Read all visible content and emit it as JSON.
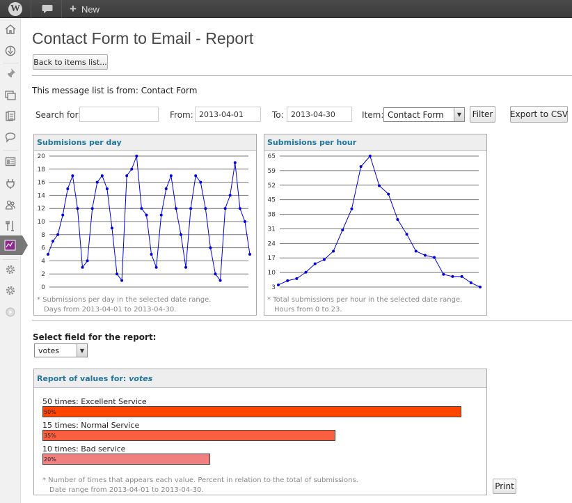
{
  "adminbar": {
    "new_label": "New"
  },
  "page": {
    "title": "Contact Form to Email - Report",
    "back_button": "Back to items list...",
    "message_list_from": "This message list is from: Contact Form"
  },
  "filters": {
    "search_label": "Search for:",
    "search_value": "",
    "from_label": "From:",
    "from_value": "2013-04-01",
    "to_label": "To:",
    "to_value": "2013-04-30",
    "item_label": "Item:",
    "item_value": "Contact Form",
    "filter_button": "Filter",
    "export_button": "Export to CSV"
  },
  "chart_data": [
    {
      "type": "line",
      "title": "Submisions per day",
      "x": [
        1,
        2,
        3,
        4,
        5,
        6,
        7,
        8,
        9,
        10,
        11,
        12,
        13,
        14,
        15,
        16,
        17,
        18,
        19,
        20,
        21,
        22,
        23,
        24,
        25,
        26,
        27,
        28,
        29,
        30
      ],
      "values": [
        5,
        7,
        8,
        11,
        15,
        17,
        12,
        3,
        4,
        12,
        16,
        17,
        15,
        9,
        2,
        1,
        17,
        18,
        20,
        12,
        11,
        5,
        3,
        11,
        15,
        17,
        12,
        8,
        3,
        12,
        17,
        16,
        12,
        6,
        2,
        1,
        12,
        14,
        19,
        12,
        10,
        5
      ],
      "ylim": [
        0,
        20
      ],
      "yticks": [
        "20",
        "18",
        "16",
        "14",
        "12",
        "10",
        "8",
        "6",
        "4",
        "2",
        "0"
      ],
      "notes": [
        "* Submissions per day in the selected date range.",
        "Days from 2013-04-01 to 2013-04-30."
      ]
    },
    {
      "type": "line",
      "title": "Submisions per hour",
      "x": [
        0,
        1,
        2,
        3,
        4,
        5,
        6,
        7,
        8,
        9,
        10,
        11,
        12,
        13,
        14,
        15,
        16,
        17,
        18,
        19,
        20,
        21,
        22,
        23
      ],
      "values": [
        4,
        6,
        7,
        10,
        14,
        16,
        20,
        30,
        40,
        60,
        65,
        51,
        47,
        35,
        28,
        20,
        18,
        17,
        9,
        8,
        8,
        5,
        3
      ],
      "ylim": [
        3,
        65
      ],
      "yticks": [
        "65",
        "59",
        "52",
        "45",
        "38",
        "31",
        "24",
        "17",
        "10",
        "3"
      ],
      "notes": [
        "* Total submissions per hour in the selected date range.",
        "Hours from 0 to 23."
      ]
    },
    {
      "type": "bar",
      "title": "Report of values for:",
      "field": "votes",
      "categories": [
        "Excellent Service",
        "Normal Service",
        "Bad service"
      ],
      "counts": [
        50,
        15,
        10
      ],
      "percents": [
        50,
        35,
        20
      ],
      "labels": [
        "50 times: Excellent Service",
        "15 times: Normal Service",
        "10 times: Bad service"
      ],
      "percent_labels": [
        "50%",
        "35%",
        "20%"
      ],
      "colors": [
        "#ff4500",
        "#fa6040",
        "#f08080"
      ],
      "notes": [
        "* Number of times that appears each value. Percent in relation to the total of submissions.",
        "Date range from 2013-04-01 to 2013-04-30."
      ]
    }
  ],
  "report": {
    "select_field_label": "Select field for the report:",
    "field_value": "votes",
    "print_button": "Print"
  },
  "colors": {
    "line": "#0000dd",
    "link": "#21759b"
  }
}
